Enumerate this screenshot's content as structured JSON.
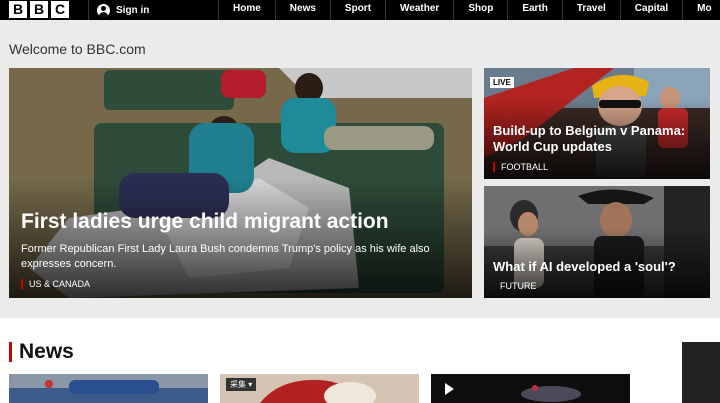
{
  "header": {
    "logo_letters": [
      "B",
      "B",
      "C"
    ],
    "sign_in": "Sign in",
    "nav": [
      "Home",
      "News",
      "Sport",
      "Weather",
      "Shop",
      "Earth",
      "Travel",
      "Capital",
      "Mo"
    ]
  },
  "welcome": "Welcome to BBC.com",
  "hero": {
    "title": "First ladies urge child migrant action",
    "summary": "Former Republican First Lady Laura Bush condemns Trump's policy as his wife also expresses concern.",
    "tag": "US & CANADA"
  },
  "side_cards": [
    {
      "live_badge": "LIVE",
      "title": "Build-up to Belgium v Panama: World Cup updates",
      "tag": "FOOTBALL"
    },
    {
      "title": "What if AI developed a 'soul'?",
      "tag": "FUTURE"
    }
  ],
  "news": {
    "heading": "News",
    "thumb_badge": "采集 ▾"
  },
  "colors": {
    "accent": "#cc0000",
    "topbar": "#000000",
    "page_bg": "#ebebeb"
  }
}
